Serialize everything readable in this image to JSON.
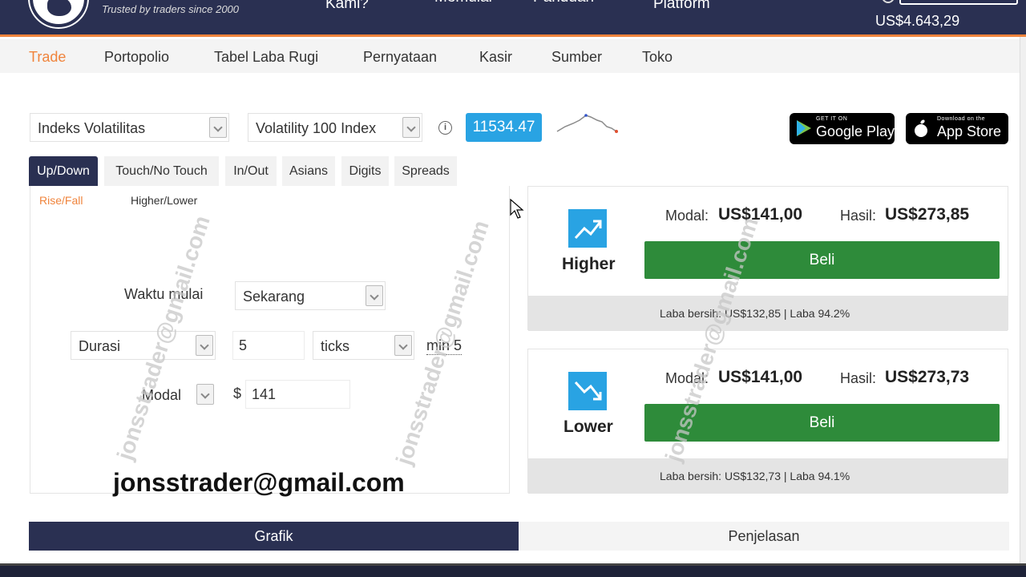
{
  "header": {
    "tagline": "Trusted by traders since 2000",
    "nav": [
      "Kami?",
      "Memulai",
      "Panduan",
      "Platform"
    ],
    "balance": "US$4.643,29"
  },
  "subnav": {
    "items": [
      "Trade",
      "Portopolio",
      "Tabel Laba Rugi",
      "Pernyataan",
      "Kasir",
      "Sumber",
      "Toko"
    ],
    "active": "Trade"
  },
  "market": {
    "category": "Indeks Volatilitas",
    "symbol": "Volatility 100 Index",
    "price": "11534.47"
  },
  "stores": {
    "google_small": "GET IT ON",
    "google_big": "Google Play",
    "apple_small": "Download on the",
    "apple_big": "App Store"
  },
  "contract_tabs": [
    "Up/Down",
    "Touch/No Touch",
    "In/Out",
    "Asians",
    "Digits",
    "Spreads"
  ],
  "sub_tabs": [
    "Rise/Fall",
    "Higher/Lower"
  ],
  "form": {
    "start_label": "Waktu mulai",
    "start_value": "Sekarang",
    "duration_label": "Durasi",
    "duration_value": "5",
    "duration_unit": "ticks",
    "duration_min": "min 5",
    "stake_label": "Modal",
    "currency": "$",
    "stake_value": "141"
  },
  "watermark": "jonsstrader@gmail.com",
  "email_overlay": "jonsstrader@gmail.com",
  "higher": {
    "label": "Higher",
    "stake_label": "Modal:",
    "stake": "US$141,00",
    "payout_label": "Hasil:",
    "payout": "US$273,85",
    "buy": "Beli",
    "profit": "Laba bersih: US$132,85 | Laba 94.2%"
  },
  "lower": {
    "label": "Lower",
    "stake_label": "Modal:",
    "stake": "US$141,00",
    "payout_label": "Hasil:",
    "payout": "US$273,73",
    "buy": "Beli",
    "profit": "Laba bersih: US$132,73 | Laba 94.1%"
  },
  "bottom_tabs": [
    "Grafik",
    "Penjelasan"
  ],
  "colors": {
    "navy": "#2a3052",
    "accent_orange": "#f0843c",
    "price_blue": "#29a3e3",
    "buy_green": "#2e8b3a"
  },
  "icons": {
    "info": "info-icon",
    "higher": "trend-up-icon",
    "lower": "trend-down-icon",
    "caret": "chevron-down-icon"
  }
}
